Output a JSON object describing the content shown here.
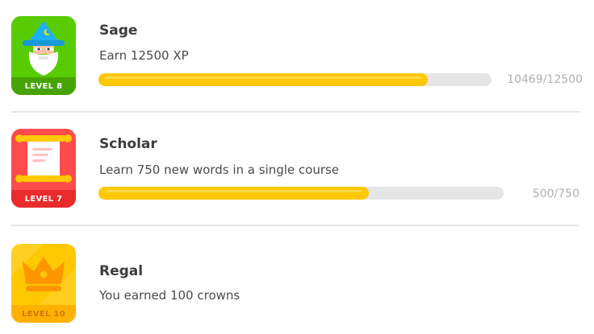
{
  "achievements": [
    {
      "title": "Sage",
      "description": "Earn 12500 XP",
      "level_label": "LEVEL 8",
      "progress_text": "10469/12500",
      "progress": 0.8375,
      "icon": "wizard-icon",
      "badge_color": "#58cc02",
      "band_color": "#46a302"
    },
    {
      "title": "Scholar",
      "description": "Learn 750 new words in a single course",
      "level_label": "LEVEL 7",
      "progress_text": "500/750",
      "progress": 0.6667,
      "icon": "scroll-icon",
      "badge_color": "#ff4b4b",
      "band_color": "#ea2b2b"
    },
    {
      "title": "Regal",
      "description": "You earned 100 crowns",
      "level_label": "LEVEL 10",
      "icon": "crown-icon",
      "badge_color": "#ffc800",
      "band_color": "#ffb100"
    }
  ],
  "colors": {
    "progress_fill": "#ffc800",
    "progress_track": "#e5e5e5",
    "divider": "#e5e5e5"
  }
}
